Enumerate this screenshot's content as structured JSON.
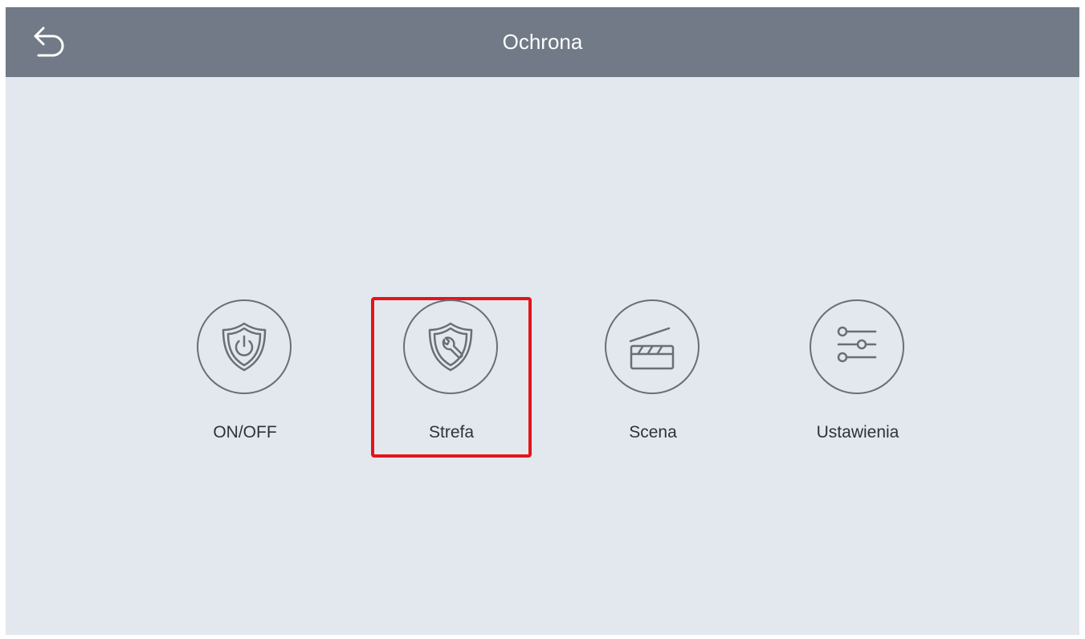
{
  "header": {
    "title": "Ochrona",
    "back_icon": "back-arrow-icon",
    "background_color": "#717a86"
  },
  "menu": {
    "selected_index": 1,
    "highlight_color": "#e3141b",
    "items": [
      {
        "label": "ON/OFF",
        "icon": "shield-power-icon"
      },
      {
        "label": "Strefa",
        "icon": "shield-wrench-icon"
      },
      {
        "label": "Scena",
        "icon": "clapperboard-icon"
      },
      {
        "label": "Ustawienia",
        "icon": "sliders-icon"
      }
    ]
  }
}
